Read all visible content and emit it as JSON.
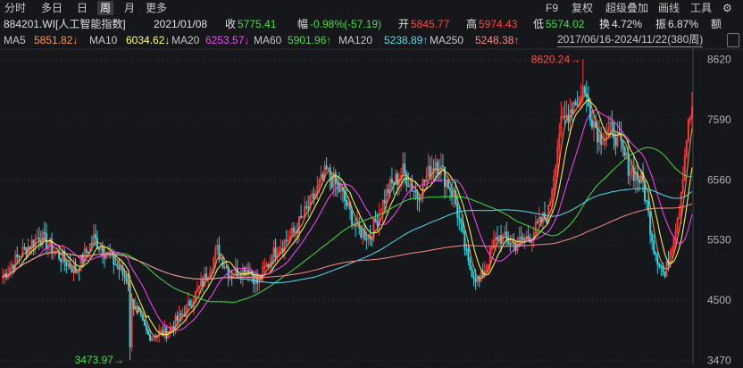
{
  "toolbar": {
    "left": [
      "分时",
      "多日",
      "日",
      "周",
      "月",
      "更多"
    ],
    "active": "周",
    "right": [
      "F9",
      "复权",
      "超级叠加",
      "画线",
      "工具"
    ],
    "gear": "gear-icon"
  },
  "info": {
    "code": "884201.WI[人工智能指数]",
    "date": "2021/01/08",
    "close_label": "收",
    "close": "5775.41",
    "change_label": "幅",
    "change": "-0.98%(-57.19)",
    "open_label": "开",
    "open": "5845.77",
    "high_label": "高",
    "high": "5974.43",
    "low_label": "低",
    "low": "5574.02",
    "turnover_label": "换",
    "turnover": "4.72%",
    "amplitude_label": "振",
    "amplitude": "6.87%",
    "amount_label": "额"
  },
  "ma": [
    {
      "name": "MA5",
      "value": "5851.82↓",
      "color": "#e8e8e8",
      "vcolor": "#ff9a3c"
    },
    {
      "name": "MA10",
      "value": "6034.62↓",
      "color": "#e8e8e8",
      "vcolor": "#ffff55"
    },
    {
      "name": "MA20",
      "value": "6253.57↓",
      "color": "#e8e8e8",
      "vcolor": "#ff44ff"
    },
    {
      "name": "MA60",
      "value": "5901.96↑",
      "color": "#e8e8e8",
      "vcolor": "#44dd44"
    },
    {
      "name": "MA120",
      "value": "5238.89↑",
      "color": "#e8e8e8",
      "vcolor": "#55ddee"
    },
    {
      "name": "MA250",
      "value": "5248.38↑",
      "color": "#e8e8e8",
      "vcolor": "#ff8a8a"
    }
  ],
  "range": "2017/06/16-2024/11/22(380周)",
  "chart_data": {
    "type": "candlestick",
    "ylim": [
      3400,
      8750
    ],
    "yticks": [
      8620,
      7590,
      6560,
      5530,
      4500,
      3470
    ],
    "high_marker": {
      "label": "8620.24",
      "index": 319,
      "value": 8620.24
    },
    "low_marker": {
      "label": "3473.97",
      "index": 70,
      "value": 3473.97
    },
    "n": 380,
    "key_closes": [
      [
        0,
        4900
      ],
      [
        10,
        5300
      ],
      [
        20,
        5600
      ],
      [
        30,
        5300
      ],
      [
        40,
        5000
      ],
      [
        50,
        5550
      ],
      [
        60,
        5200
      ],
      [
        70,
        4800
      ],
      [
        72,
        4400
      ],
      [
        80,
        3900
      ],
      [
        90,
        3950
      ],
      [
        100,
        4300
      ],
      [
        110,
        4800
      ],
      [
        118,
        5350
      ],
      [
        125,
        4950
      ],
      [
        135,
        5050
      ],
      [
        140,
        4800
      ],
      [
        150,
        5350
      ],
      [
        160,
        5650
      ],
      [
        170,
        6200
      ],
      [
        178,
        6700
      ],
      [
        186,
        6350
      ],
      [
        195,
        5700
      ],
      [
        202,
        5600
      ],
      [
        212,
        6400
      ],
      [
        220,
        6700
      ],
      [
        228,
        6300
      ],
      [
        238,
        6900
      ],
      [
        248,
        6300
      ],
      [
        256,
        5100
      ],
      [
        262,
        4800
      ],
      [
        272,
        5600
      ],
      [
        282,
        5450
      ],
      [
        290,
        5600
      ],
      [
        300,
        6000
      ],
      [
        306,
        7400
      ],
      [
        314,
        7900
      ],
      [
        320,
        8000
      ],
      [
        328,
        7300
      ],
      [
        336,
        7400
      ],
      [
        344,
        6800
      ],
      [
        352,
        6500
      ],
      [
        358,
        5400
      ],
      [
        364,
        4900
      ],
      [
        372,
        6100
      ],
      [
        376,
        7300
      ],
      [
        379,
        7800
      ]
    ]
  }
}
